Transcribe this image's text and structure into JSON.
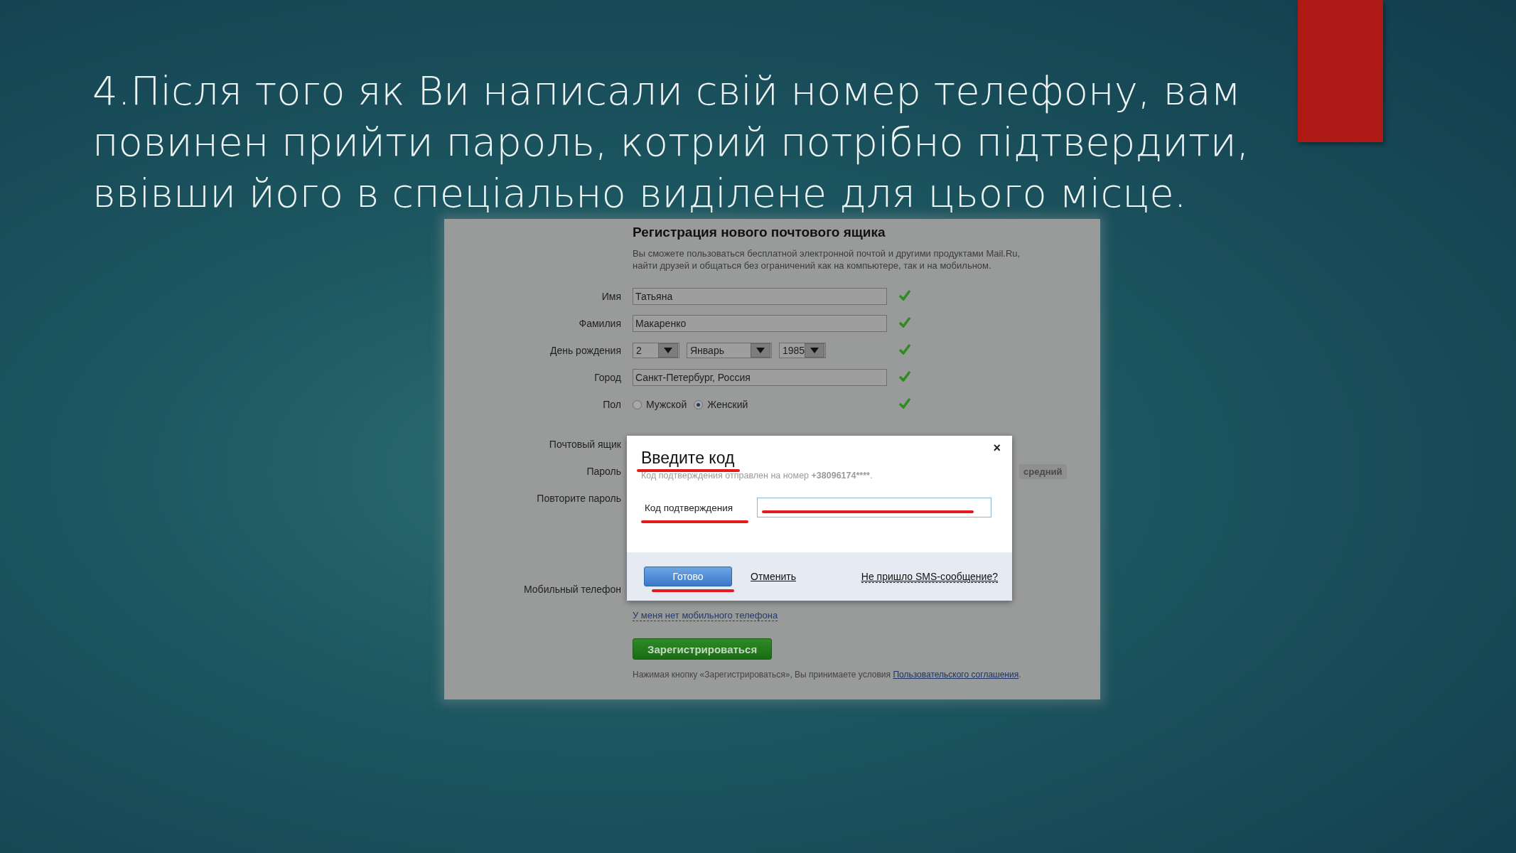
{
  "slide": {
    "heading": "4.Після того як Ви написали свій номер телефону, вам повинен прийти пароль, котрий потрібно підтвердити, ввівши його в спеціально виділене для цього місце."
  },
  "form": {
    "title": "Регистрация нового почтового ящика",
    "intro": "Вы сможете пользоваться бесплатной электронной почтой и другими продуктами Mail.Ru, найти друзей и общаться без ограничений как на компьютере, так и на мобильном.",
    "fields": [
      {
        "label": "Имя",
        "kind": "text",
        "value": "Татьяна",
        "valid": true
      },
      {
        "label": "Фамилия",
        "kind": "text",
        "value": "Макаренко",
        "valid": true
      },
      {
        "label": "День рождения",
        "kind": "date",
        "parts": [
          "2",
          "Январь",
          "1985"
        ],
        "valid": true
      },
      {
        "label": "Город",
        "kind": "text",
        "value": "Санкт-Петербург, Россия",
        "valid": true
      },
      {
        "label": "Пол",
        "kind": "radio",
        "options": [
          {
            "label": "Мужской",
            "selected": false
          },
          {
            "label": "Женский",
            "selected": true
          }
        ],
        "valid": true
      },
      {
        "label": "Почтовый ящик",
        "kind": "hidden"
      },
      {
        "label": "Пароль",
        "kind": "hidden",
        "strength": "средний"
      },
      {
        "label": "Повторите пароль",
        "kind": "hidden"
      },
      {
        "label": "Мобильный телефон",
        "kind": "phone"
      }
    ],
    "no_phone_link": "У меня нет мобильного телефона",
    "register_button": "Зарегистрироваться",
    "terms": {
      "text": "Нажимая кнопку «Зарегистрироваться», Вы принимаете условия ",
      "link": "Пользовательского соглашения",
      "end": "."
    }
  },
  "modal": {
    "close": "×",
    "title": "Введите код",
    "note": "Код подтверждения отправлен на номер ",
    "phone": "+38096174****",
    "note_end": ".",
    "field_label": "Код подтверждения",
    "ok": "Готово",
    "cancel": "Отменить",
    "no_sms": "Не пришло SMS-сообщение?"
  }
}
